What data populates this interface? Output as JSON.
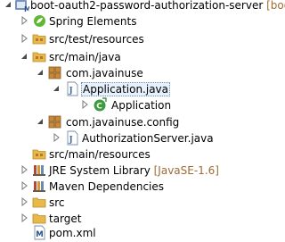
{
  "explorer": {
    "project": {
      "name": "boot-oauth2-password-authorization-server",
      "decoration": "[boo"
    },
    "items": [
      {
        "label": "Spring Elements"
      },
      {
        "label": "src/test/resources"
      },
      {
        "label": "src/main/java"
      },
      {
        "label": "com.javainuse"
      },
      {
        "label": "Application.java",
        "selected": true
      },
      {
        "label": "Application"
      },
      {
        "label": "com.javainuse.config"
      },
      {
        "label": "AuthorizationServer.java"
      },
      {
        "label": "src/main/resources"
      },
      {
        "label": "JRE System Library",
        "decoration": "[JavaSE-1.6]"
      },
      {
        "label": "Maven Dependencies"
      },
      {
        "label": "src"
      },
      {
        "label": "target"
      },
      {
        "label": "pom.xml"
      }
    ]
  },
  "colors": {
    "selection": "#e6f1fc",
    "decoration_text": "#a06a33",
    "folder": "#e8b94a",
    "package": "#b5772a",
    "java_file": "#4a6fa5",
    "class_green": "#3c9b3c"
  },
  "icons": [
    "project-icon",
    "spring-icon",
    "source-folder-icon",
    "package-icon",
    "java-file-icon",
    "class-icon",
    "library-icon",
    "folder-icon",
    "xml-file-icon"
  ]
}
